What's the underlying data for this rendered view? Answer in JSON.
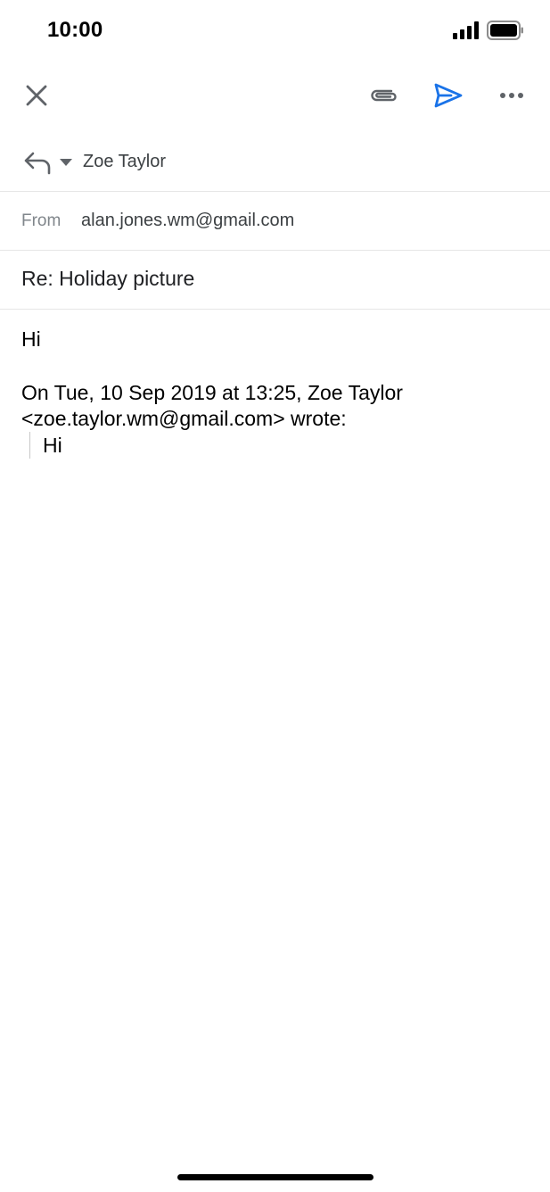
{
  "status_bar": {
    "time": "10:00"
  },
  "toolbar": {
    "icons": [
      "close-icon",
      "attachment-icon",
      "send-icon",
      "more-icon"
    ],
    "accent_color": "#1a73e8"
  },
  "compose": {
    "to": {
      "name": "Zoe Taylor"
    },
    "from": {
      "label": "From",
      "value": "alan.jones.wm@gmail.com"
    },
    "subject": "Re: Holiday picture",
    "body": "Hi",
    "quoted": {
      "header": "On Tue, 10 Sep 2019 at 13:25, Zoe Taylor <zoe.taylor.wm@gmail.com> wrote:",
      "text": "Hi"
    }
  }
}
